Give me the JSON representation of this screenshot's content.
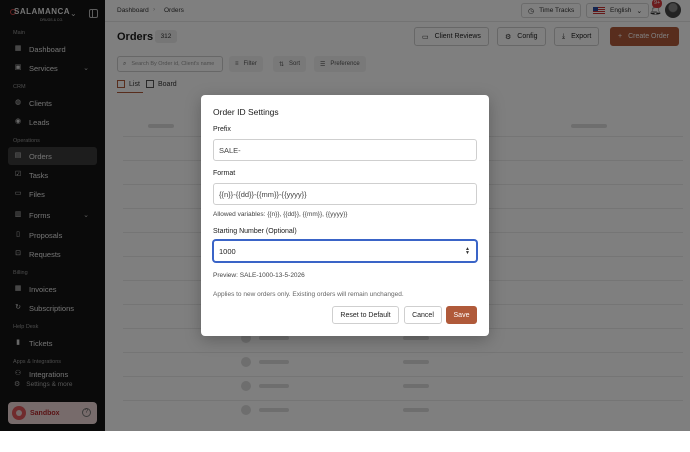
{
  "sidebar": {
    "brand": {
      "name": "SALAMANCA",
      "tagline": "DRUGS & CO."
    },
    "sections": {
      "main": "Main",
      "crm": "CRM",
      "operations": "Operations",
      "billing": "Billing",
      "helpdesk": "Help Desk",
      "apps": "Apps & Integrations"
    },
    "items": {
      "dashboard": "Dashboard",
      "services": "Services",
      "clients": "Clients",
      "leads": "Leads",
      "orders": "Orders",
      "tasks": "Tasks",
      "files": "Files",
      "forms": "Forms",
      "proposals": "Proposals",
      "requests": "Requests",
      "invoices": "Invoices",
      "subscriptions": "Subscriptions",
      "tickets": "Tickets",
      "integrations": "Integrations"
    },
    "settings": "Settings & more",
    "sandbox": "Sandbox",
    "help_glyph": "?"
  },
  "topbar": {
    "crumbs": [
      "Dashboard",
      "Orders"
    ],
    "crumb_sep": "›",
    "time_tracks": "Time Tracks",
    "language": "English",
    "notifications": "9+"
  },
  "main": {
    "title": "Orders",
    "count": "312",
    "buttons": {
      "client_reviews": "Client Reviews",
      "config": "Config",
      "export": "Export",
      "create_order": "Create Order"
    },
    "search_placeholder": "Search By Order id, Client's name",
    "filter": "Filter",
    "sort": "Sort",
    "preference": "Preference",
    "views": {
      "list": "List",
      "board": "Board"
    }
  },
  "modal": {
    "title": "Order ID Settings",
    "prefix_label": "Prefix",
    "prefix_value": "SALE-",
    "format_label": "Format",
    "format_value": "{{n}}-{{dd}}-{{mm}}-{{yyyy}}",
    "allowed_vars": "Allowed variables: {{n}}, {{dd}}, {{mm}}, {{yyyy}}",
    "start_label": "Starting Number (Optional)",
    "start_value": "1000",
    "preview": "Preview: SALE-1000-13-5-2026",
    "note": "Applies to new orders only. Existing orders will remain unchanged.",
    "buttons": {
      "reset": "Reset to Default",
      "cancel": "Cancel",
      "save": "Save"
    }
  },
  "colors": {
    "accent": "#b05a3a",
    "focus": "#3a64c7",
    "sidebar": "#141414"
  },
  "icons": {
    "dashboard": "grid-icon",
    "services": "briefcase-icon",
    "clients": "users-icon",
    "leads": "user-icon",
    "orders": "orders-icon",
    "tasks": "checklist-icon",
    "files": "folder-icon",
    "forms": "form-icon",
    "proposals": "document-icon",
    "requests": "inbox-icon",
    "invoices": "invoice-icon",
    "subscriptions": "refresh-icon",
    "tickets": "ticket-icon",
    "integrations": "plug-icon"
  }
}
